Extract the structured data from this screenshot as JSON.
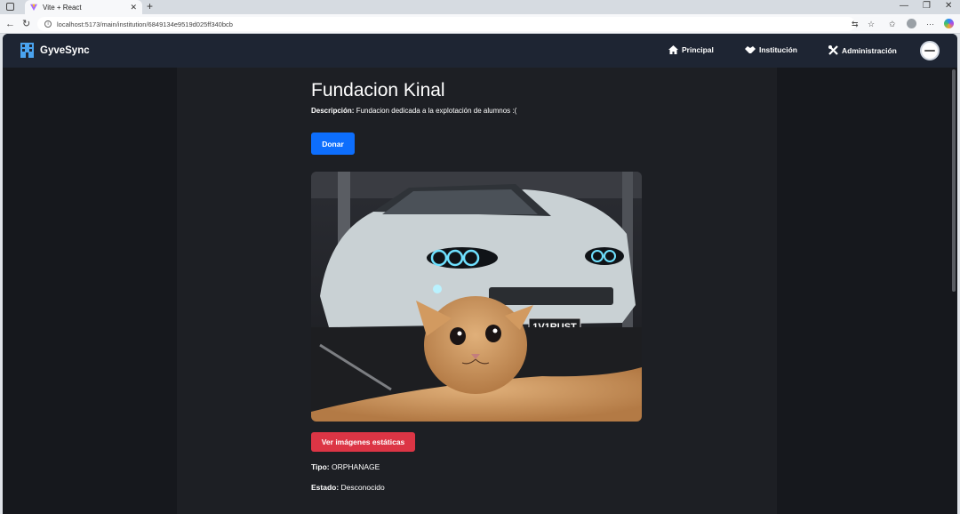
{
  "browser": {
    "tab_title": "Vite + React",
    "url": "localhost:5173/main/institution/6849134e9519d025ff340bcb"
  },
  "navbar": {
    "brand": "GyveSync",
    "links": [
      {
        "label": "Principal",
        "icon": "home-icon"
      },
      {
        "label": "Institución",
        "icon": "handshake-icon"
      },
      {
        "label": "Administración",
        "icon": "tools-icon"
      }
    ]
  },
  "institution": {
    "name": "Fundacion Kinal",
    "description_label": "Descripción:",
    "description": "Fundacion dedicada a la explotación de alumnos :(",
    "donate_button": "Donar",
    "image_alt": "cat selfie in front of white sports car",
    "plate_text": "1V1RUST",
    "static_images_button": "Ver imágenes estáticas",
    "type_label": "Tipo:",
    "type": "ORPHANAGE",
    "status_label": "Estado:",
    "status": "Desconocido"
  },
  "colors": {
    "navbar": "#1e2533",
    "primary": "#0d6efd",
    "danger": "#dc3545",
    "brand_icon": "#4aa3ef"
  }
}
